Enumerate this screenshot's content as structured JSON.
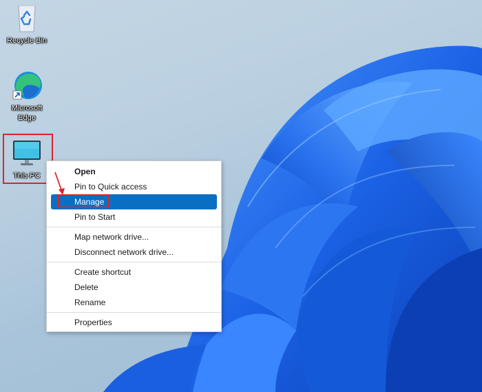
{
  "desktop": {
    "icons": [
      {
        "label": "Recycle Bin",
        "icon": "recycle-bin-icon"
      },
      {
        "label": "Microsoft\nEdge",
        "icon": "edge-icon"
      },
      {
        "label": "This PC",
        "icon": "monitor-icon"
      }
    ]
  },
  "context_menu": {
    "groups": [
      [
        {
          "label": "Open",
          "bold": true
        },
        {
          "label": "Pin to Quick access"
        },
        {
          "label": "Manage",
          "selected": true
        },
        {
          "label": "Pin to Start"
        }
      ],
      [
        {
          "label": "Map network drive..."
        },
        {
          "label": "Disconnect network drive..."
        }
      ],
      [
        {
          "label": "Create shortcut"
        },
        {
          "label": "Delete"
        },
        {
          "label": "Rename"
        }
      ],
      [
        {
          "label": "Properties"
        }
      ]
    ]
  },
  "colors": {
    "highlight_accent": "#0a6fc2",
    "annotation_red": "#d8262e",
    "bloom_blue": "#1f6ee8"
  }
}
